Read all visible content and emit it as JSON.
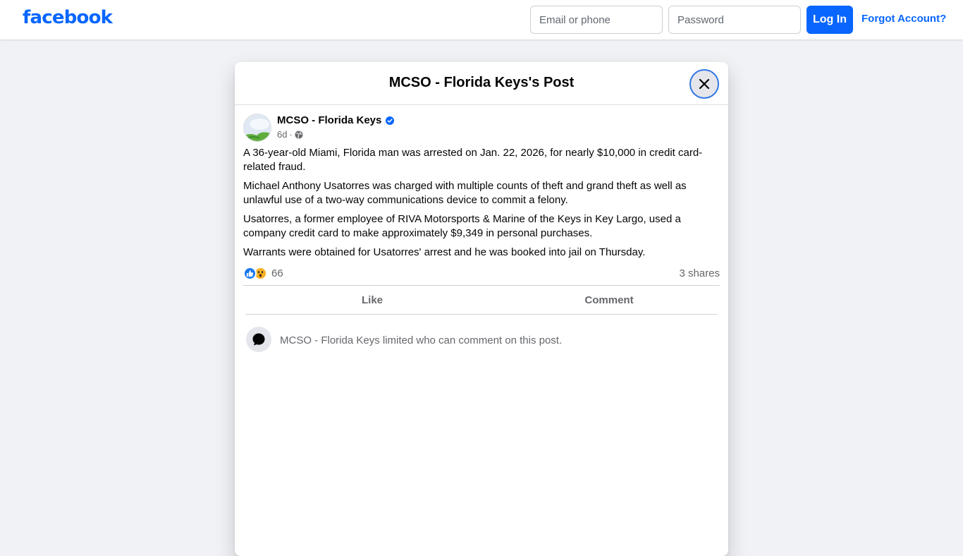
{
  "header": {
    "logo_text": "facebook",
    "email_placeholder": "Email or phone",
    "password_placeholder": "Password",
    "login_label": "Log In",
    "forgot_label": "Forgot Account?"
  },
  "modal": {
    "title": "MCSO - Florida Keys's Post",
    "close_icon": "close-icon"
  },
  "post": {
    "author": "MCSO - Florida Keys",
    "verified": true,
    "time": "6d",
    "separator": "·",
    "audience_icon": "globe-icon",
    "paragraphs": [
      "A 36-year-old Miami, Florida man was arrested on Jan. 22, 2026, for nearly $10,000 in credit card-related fraud.",
      "Michael Anthony Usatorres was charged with multiple counts of theft and grand theft as well as unlawful use of a two-way communications device to commit a felony.",
      "Usatorres, a former employee of RIVA Motorsports & Marine of the Keys in Key Largo, used a company credit card to make approximately $9,349 in personal purchases.",
      "Warrants were obtained for Usatorres' arrest and he was booked into jail on Thursday."
    ],
    "reactions": [
      "like",
      "wow"
    ],
    "reaction_count": "66",
    "shares": "3 shares",
    "actions": {
      "like_label": "Like",
      "comment_label": "Comment"
    },
    "limited_notice": "MCSO - Florida Keys limited who can comment on this post."
  },
  "colors": {
    "brand": "#0866ff",
    "background": "#f0f2f5",
    "secondary_text": "#65676b"
  }
}
